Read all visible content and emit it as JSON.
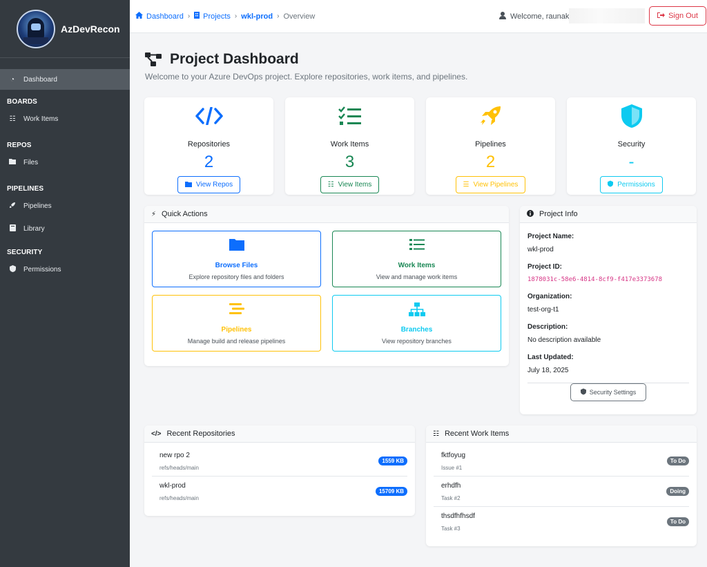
{
  "app": {
    "name": "AzDevRecon"
  },
  "sidebar": {
    "dashboard": "Dashboard",
    "sections": [
      {
        "title": "BOARDS",
        "items": [
          {
            "label": "Work Items",
            "icon": "list-check-icon"
          }
        ]
      },
      {
        "title": "REPOS",
        "items": [
          {
            "label": "Files",
            "icon": "folder-icon"
          }
        ]
      },
      {
        "title": "PIPELINES",
        "items": [
          {
            "label": "Pipelines",
            "icon": "rocket-icon"
          },
          {
            "label": "Library",
            "icon": "book-icon"
          }
        ]
      },
      {
        "title": "SECURITY",
        "items": [
          {
            "label": "Permissions",
            "icon": "shield-icon"
          }
        ]
      }
    ]
  },
  "topbar": {
    "breadcrumb": {
      "dashboard": "Dashboard",
      "projects": "Projects",
      "project": "wkl-prod",
      "current": "Overview"
    },
    "welcome": "Welcome, raunakp",
    "signout": "Sign Out"
  },
  "header": {
    "title": "Project Dashboard",
    "subtitle": "Welcome to your Azure DevOps project. Explore repositories, work items, and pipelines."
  },
  "stats": [
    {
      "label": "Repositories",
      "value": "2",
      "button": "View Repos",
      "color": "#0d6efd"
    },
    {
      "label": "Work Items",
      "value": "3",
      "button": "View Items",
      "color": "#198754"
    },
    {
      "label": "Pipelines",
      "value": "2",
      "button": "View Pipelines",
      "color": "#ffc107"
    },
    {
      "label": "Security",
      "value": "-",
      "button": "Permissions",
      "color": "#0dcaf0"
    }
  ],
  "quick_actions": {
    "title": "Quick Actions",
    "items": [
      {
        "title": "Browse Files",
        "desc": "Explore repository files and folders",
        "color": "#0d6efd"
      },
      {
        "title": "Work Items",
        "desc": "View and manage work items",
        "color": "#198754"
      },
      {
        "title": "Pipelines",
        "desc": "Manage build and release pipelines",
        "color": "#ffc107"
      },
      {
        "title": "Branches",
        "desc": "View repository branches",
        "color": "#0dcaf0"
      }
    ]
  },
  "project_info": {
    "title": "Project Info",
    "name_label": "Project Name:",
    "name": "wkl-prod",
    "id_label": "Project ID:",
    "id": "1878031c-58e6-4814-8cf9-f417e3373678",
    "org_label": "Organization:",
    "org": "test-org-t1",
    "desc_label": "Description:",
    "desc": "No description available",
    "updated_label": "Last Updated:",
    "updated": "July 18, 2025",
    "button": "Security Settings"
  },
  "recent_repos": {
    "title": "Recent Repositories",
    "items": [
      {
        "name": "new rpo 2",
        "ref": "refs/heads/main",
        "size": "1559 KB"
      },
      {
        "name": "wkl-prod",
        "ref": "refs/heads/main",
        "size": "15709 KB"
      }
    ]
  },
  "recent_work_items": {
    "title": "Recent Work Items",
    "items": [
      {
        "name": "fktfoyug",
        "sub": "Issue #1",
        "status": "To Do"
      },
      {
        "name": "erhdfh",
        "sub": "Task #2",
        "status": "Doing"
      },
      {
        "name": "thsdfhfhsdf",
        "sub": "Task #3",
        "status": "To Do"
      }
    ]
  }
}
